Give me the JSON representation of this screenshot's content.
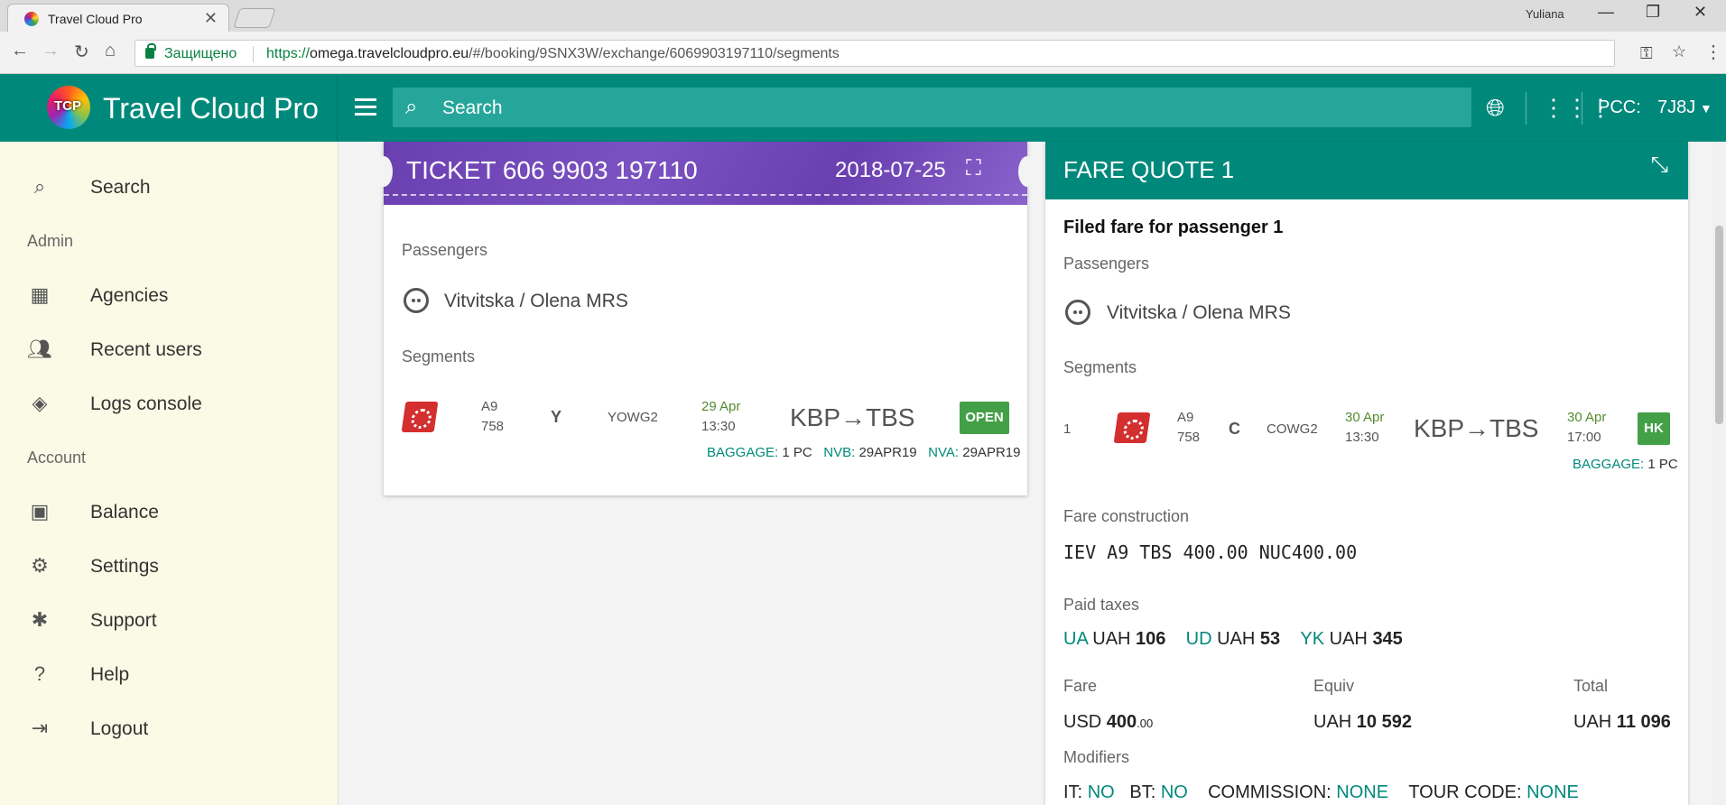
{
  "browser": {
    "tab_title": "Travel Cloud Pro",
    "user": "Yuliana",
    "secure_label": "Защищено",
    "url_scheme": "https://",
    "url_host": "omega.travelcloudpro.eu",
    "url_path": "/#/booking/9SNX3W/exchange/6069903197110/segments"
  },
  "header": {
    "logo_text": "TCP",
    "brand": "Travel Cloud Pro",
    "search_placeholder": "Search",
    "pcc_label": "PCC:",
    "pcc_value": "7J8J"
  },
  "sidebar": {
    "items": [
      {
        "label": "Search",
        "icon": "search-icon"
      },
      {
        "label": "Agencies",
        "icon": "building-icon"
      },
      {
        "label": "Recent users",
        "icon": "people-icon"
      },
      {
        "label": "Logs console",
        "icon": "compass-icon"
      },
      {
        "label": "Balance",
        "icon": "wallet-icon"
      },
      {
        "label": "Settings",
        "icon": "gear-icon"
      },
      {
        "label": "Support",
        "icon": "bug-icon"
      },
      {
        "label": "Help",
        "icon": "help-icon"
      },
      {
        "label": "Logout",
        "icon": "logout-icon"
      }
    ],
    "sections": {
      "admin": "Admin",
      "account": "Account"
    }
  },
  "ticket": {
    "title": "TICKET  606 9903 197110",
    "date": "2018-07-25",
    "passengers_label": "Passengers",
    "passenger": "Vitvitska / Olena MRS",
    "segments_label": "Segments",
    "segment": {
      "carrier": "A9",
      "flight": "758",
      "class": "Y",
      "fare_basis": "YOWG2",
      "dep_date": "29 Apr",
      "dep_time": "13:30",
      "route": "KBP→TBS",
      "status": "OPEN",
      "baggage_label": "BAGGAGE:",
      "baggage_value": "1 PC",
      "nvb_label": "NVB:",
      "nvb_value": "29APR19",
      "nva_label": "NVA:",
      "nva_value": "29APR19"
    }
  },
  "fare_quote": {
    "title": "FARE QUOTE 1",
    "filed_for": "Filed fare for passenger 1",
    "passengers_label": "Passengers",
    "passenger": "Vitvitska / Olena MRS",
    "segments_label": "Segments",
    "segment": {
      "num": "1",
      "carrier": "A9",
      "flight": "758",
      "class": "C",
      "fare_basis": "COWG2",
      "dep_date": "30 Apr",
      "dep_time": "13:30",
      "route": "KBP→TBS",
      "arr_date": "30 Apr",
      "arr_time": "17:00",
      "status": "HK",
      "baggage_label": "BAGGAGE:",
      "baggage_value": "1 PC"
    },
    "construction_label": "Fare construction",
    "construction": "IEV A9 TBS 400.00 NUC400.00",
    "taxes_label": "Paid taxes",
    "taxes": [
      {
        "code": "UA",
        "currency": "UAH",
        "amount": "106"
      },
      {
        "code": "UD",
        "currency": "UAH",
        "amount": "53"
      },
      {
        "code": "YK",
        "currency": "UAH",
        "amount": "345"
      }
    ],
    "fare_label": "Fare",
    "fare_currency": "USD",
    "fare_amount": "400",
    "fare_cents": ".00",
    "equiv_label": "Equiv",
    "equiv_currency": "UAH",
    "equiv_amount": "10 592",
    "total_label": "Total",
    "total_currency": "UAH",
    "total_amount": "11 096",
    "modifiers_label": "Modifiers",
    "modifiers": [
      {
        "key": "IT:",
        "value": "NO"
      },
      {
        "key": "BT:",
        "value": "NO"
      },
      {
        "key": "COMMISSION:",
        "value": "NONE"
      },
      {
        "key": "TOUR CODE:",
        "value": "NONE"
      }
    ]
  },
  "colors": {
    "primary": "#00897b",
    "ticket_header": "#6a3fb0",
    "status_green": "#43a047",
    "sidebar_bg": "#fafae6"
  }
}
